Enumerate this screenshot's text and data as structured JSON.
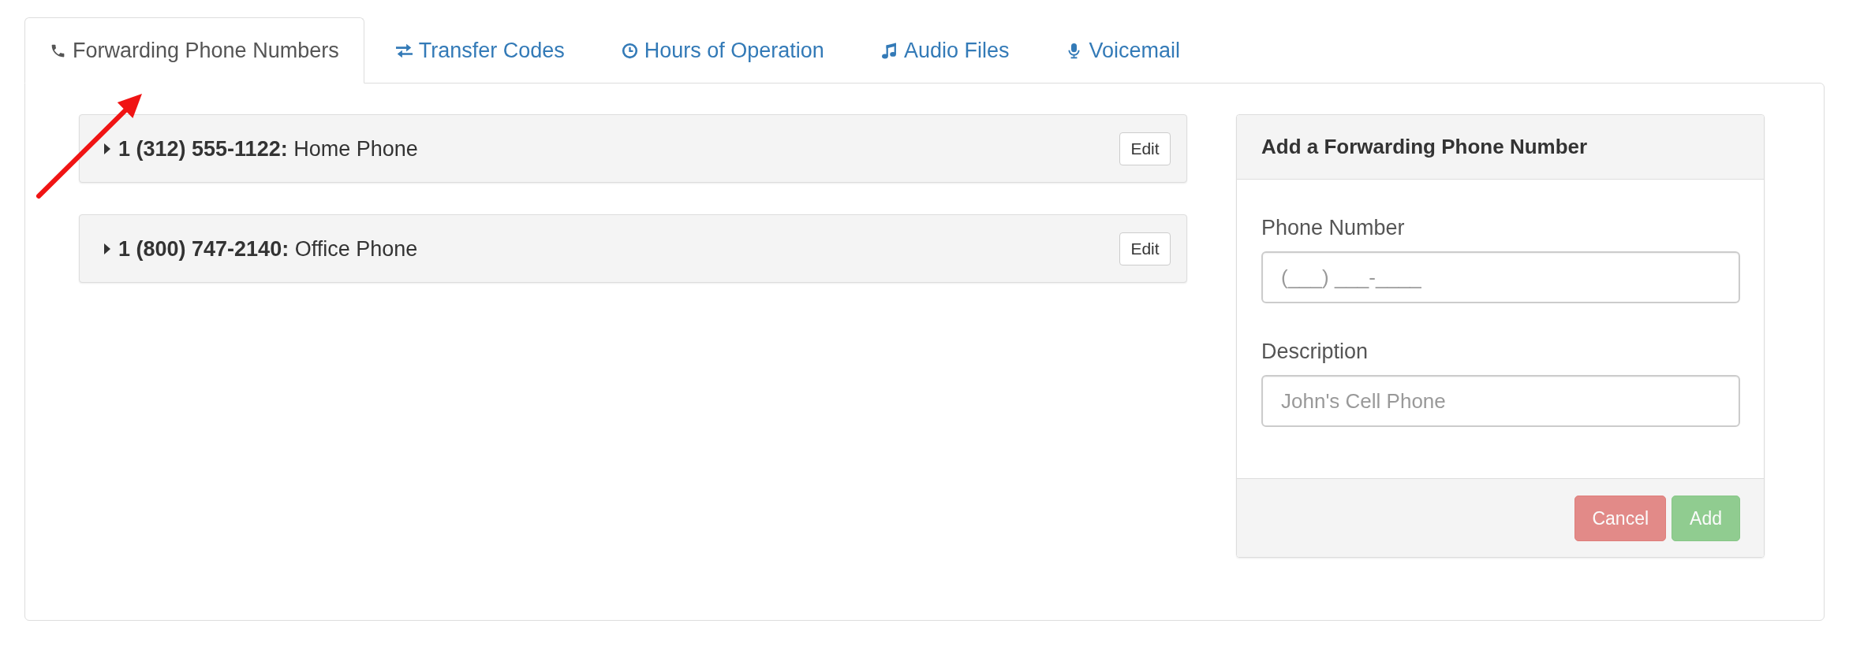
{
  "tabs": [
    {
      "label": "Forwarding Phone Numbers",
      "selected": true
    },
    {
      "label": "Transfer Codes",
      "selected": false
    },
    {
      "label": "Hours of Operation",
      "selected": false
    },
    {
      "label": "Audio Files",
      "selected": false
    },
    {
      "label": "Voicemail",
      "selected": false
    }
  ],
  "forwarding_numbers": [
    {
      "title": "**1 (312) 555-1122:** Home Phone",
      "expanded": false,
      "button": "Edit"
    },
    {
      "title": "**1 (800) 747-2140:** Office Phone",
      "expanded": false,
      "button": "Edit"
    }
  ],
  "add_form": {
    "title": "Add a Forwarding Phone Number",
    "fields": [
      {
        "label": "Phone Number",
        "placeholder": "(___) ___-____"
      },
      {
        "label": "Description",
        "placeholder": "John's Cell Phone"
      }
    ],
    "buttons": [
      {
        "label": "Cancel",
        "kind": "danger",
        "disabled": true
      },
      {
        "label": "Add",
        "kind": "success",
        "disabled": true
      }
    ]
  },
  "annotations": [
    {
      "kind": "arrow"
    }
  ]
}
